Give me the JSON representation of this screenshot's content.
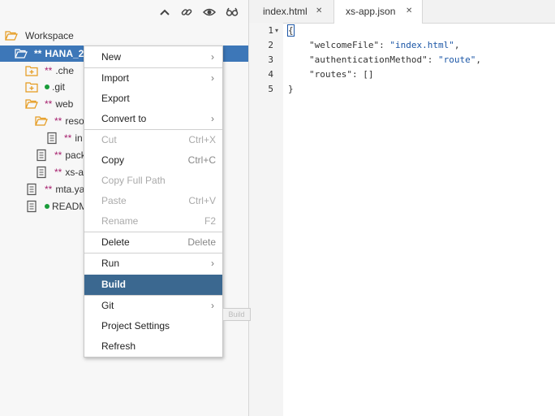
{
  "toolbar": {
    "icons": [
      "collapse-icon",
      "link-icon",
      "eye-icon",
      "glasses-icon"
    ]
  },
  "tree": {
    "workspace": "Workspace",
    "project": {
      "modified": "**",
      "label": "HANA_2"
    },
    "items": [
      {
        "modified": "**",
        "label": ".che",
        "icon": "folder-icon"
      },
      {
        "modified": "",
        "label": ".git",
        "icon": "folder-icon",
        "dot": true
      },
      {
        "modified": "**",
        "label": "web",
        "icon": "folder-open-icon"
      },
      {
        "modified": "**",
        "label": "reso",
        "icon": "folder-open-icon"
      },
      {
        "modified": "**",
        "label": "in",
        "icon": "file-icon"
      },
      {
        "modified": "**",
        "label": "pack",
        "icon": "file-icon"
      },
      {
        "modified": "**",
        "label": "xs-a",
        "icon": "file-icon"
      },
      {
        "modified": "**",
        "label": "mta.ya",
        "icon": "file-icon"
      },
      {
        "modified": "",
        "label": "READM",
        "icon": "file-icon",
        "dot": true
      }
    ]
  },
  "tabs": [
    {
      "label": "index.html",
      "close": "✕"
    },
    {
      "label": "xs-app.json",
      "close": "✕"
    }
  ],
  "editor": {
    "lines": [
      "1",
      "2",
      "3",
      "4",
      "5"
    ],
    "code": {
      "l1": "{",
      "l2_key": "\"welcomeFile\": ",
      "l2_val": "\"index.html\"",
      "l2_end": ",",
      "l3_key": "\"authenticationMethod\": ",
      "l3_val": "\"route\"",
      "l3_end": ",",
      "l4": "\"routes\": []",
      "l5": "}"
    }
  },
  "menu": {
    "items": [
      {
        "label": "New",
        "submenu": true
      },
      {
        "label": "Import",
        "submenu": true
      },
      {
        "label": "Export"
      },
      {
        "label": "Convert to",
        "submenu": true
      },
      {
        "label": "Cut",
        "shortcut": "Ctrl+X",
        "disabled": true
      },
      {
        "label": "Copy",
        "shortcut": "Ctrl+C"
      },
      {
        "label": "Copy Full Path",
        "disabled": true
      },
      {
        "label": "Paste",
        "shortcut": "Ctrl+V",
        "disabled": true
      },
      {
        "label": "Rename",
        "shortcut": "F2",
        "disabled": true
      },
      {
        "label": "Delete",
        "shortcut": "Delete"
      },
      {
        "label": "Run",
        "submenu": true
      },
      {
        "label": "Build",
        "active": true
      },
      {
        "label": "Git",
        "submenu": true
      },
      {
        "label": "Project Settings"
      },
      {
        "label": "Refresh"
      }
    ],
    "arrow": "›",
    "ghost": "Build"
  }
}
